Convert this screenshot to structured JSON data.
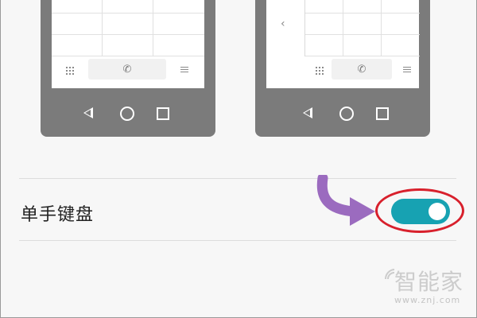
{
  "settings": {
    "one_handed_keyboard": {
      "label": "单手键盘",
      "enabled": true,
      "toggle_color": "#17a2b2"
    }
  },
  "annotation": {
    "arrow_color": "#9b6bbf",
    "highlight_color": "#d8202c"
  },
  "illustration": {
    "icons": [
      "dialpad-grid-icon",
      "phone-icon",
      "menu-icon",
      "back-icon",
      "home-icon",
      "recents-icon",
      "chevron-left-icon"
    ],
    "phone_color": "#7b7b7b"
  },
  "watermark": {
    "brand": "智能家",
    "url": "www.znj.com"
  }
}
